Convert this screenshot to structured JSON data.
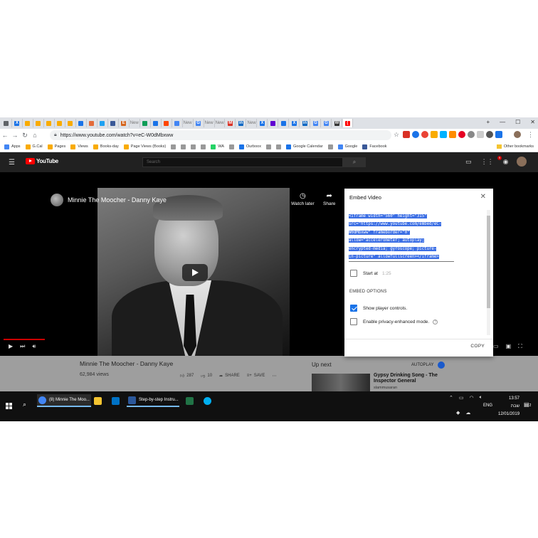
{
  "browser": {
    "tabs": [
      {
        "icon": "settings-icon",
        "label": "",
        "color": "#5f6368"
      },
      {
        "icon": "x-icon",
        "label": "X",
        "color": "#1a73e8"
      },
      {
        "icon": "analytics-icon",
        "label": "",
        "color": "#f9ab00"
      },
      {
        "icon": "analytics-icon",
        "label": "",
        "color": "#f9ab00"
      },
      {
        "icon": "analytics-icon",
        "label": "",
        "color": "#f9ab00"
      },
      {
        "icon": "analytics-icon",
        "label": "",
        "color": "#f9ab00"
      },
      {
        "icon": "analytics-icon",
        "label": "",
        "color": "#f9ab00"
      },
      {
        "icon": "calendar-icon",
        "label": "",
        "color": "#1a73e8"
      },
      {
        "icon": "sun-icon",
        "label": "",
        "color": "#e36c3b"
      },
      {
        "icon": "compass-icon",
        "label": "",
        "color": "#1da1f2"
      },
      {
        "icon": "facebook-icon",
        "label": "",
        "color": "#3b5998"
      },
      {
        "icon": "etsy-icon",
        "label": "E",
        "color": "#d5641c"
      },
      {
        "icon": "doc-icon",
        "label": "New",
        "color": "#777"
      },
      {
        "icon": "sheet-icon",
        "label": "",
        "color": "#0f9d58"
      },
      {
        "icon": "calendar-icon",
        "label": "",
        "color": "#1a73e8"
      },
      {
        "icon": "reddit-icon",
        "label": "",
        "color": "#ff4500"
      },
      {
        "icon": "chrome-icon",
        "label": "",
        "color": "#4285f4"
      },
      {
        "icon": "doc-icon",
        "label": "New",
        "color": "#777"
      },
      {
        "icon": "google-icon",
        "label": "G",
        "color": "#4285f4"
      },
      {
        "icon": "doc-icon",
        "label": "New",
        "color": "#777"
      },
      {
        "icon": "doc-icon",
        "label": "New",
        "color": "#777"
      },
      {
        "icon": "gmail-icon",
        "label": "M",
        "color": "#d93025"
      },
      {
        "icon": "linkedin-icon",
        "label": "in",
        "color": "#0a66c2"
      },
      {
        "icon": "doc-icon",
        "label": "New",
        "color": "#777"
      },
      {
        "icon": "x-icon",
        "label": "X",
        "color": "#1a73e8"
      },
      {
        "icon": "yahoo-icon",
        "label": "",
        "color": "#6001d2"
      },
      {
        "icon": "calendar-icon",
        "label": "",
        "color": "#1a73e8"
      },
      {
        "icon": "x-icon",
        "label": "X",
        "color": "#1a73e8"
      },
      {
        "icon": "linkedin-icon",
        "label": "in",
        "color": "#0a66c2"
      },
      {
        "icon": "google-icon",
        "label": "G",
        "color": "#4285f4"
      },
      {
        "icon": "google-icon",
        "label": "G",
        "color": "#4285f4"
      },
      {
        "icon": "wikipedia-icon",
        "label": "W",
        "color": "#333"
      },
      {
        "icon": "youtube-icon",
        "label": "(",
        "color": "#ff0000"
      }
    ],
    "url": "https://www.youtube.com/watch?v=eC-W0dMbxww",
    "bookmarks": [
      {
        "label": "Apps",
        "color": "#4285f4"
      },
      {
        "label": "G.Cal",
        "color": "#f9ab00"
      },
      {
        "label": "Pages",
        "color": "#f9ab00"
      },
      {
        "label": "Views",
        "color": "#f9ab00"
      },
      {
        "label": "Books-day",
        "color": "#f9ab00"
      },
      {
        "label": "Page Views (Books)",
        "color": "#f9ab00"
      },
      {
        "label": "",
        "color": "#999"
      },
      {
        "label": "",
        "color": "#999"
      },
      {
        "label": "",
        "color": "#999"
      },
      {
        "label": "",
        "color": "#999"
      },
      {
        "label": "WA",
        "color": "#25d366"
      },
      {
        "label": "",
        "color": "#999"
      },
      {
        "label": "Ourboox",
        "color": "#1a73e8"
      },
      {
        "label": "",
        "color": "#999"
      },
      {
        "label": "",
        "color": "#999"
      },
      {
        "label": "Google Calendar",
        "color": "#1a73e8"
      },
      {
        "label": "",
        "color": "#999"
      },
      {
        "label": "Google",
        "color": "#4285f4"
      },
      {
        "label": "Facebook",
        "color": "#3b5998"
      }
    ],
    "other_bookmarks": "Other bookmarks"
  },
  "youtube": {
    "logo_text": "YouTube",
    "search_placeholder": "Search",
    "notification_count": "9",
    "player": {
      "title": "Minnie The Moocher - Danny Kaye",
      "watch_later": "Watch later",
      "share": "Share"
    },
    "video_title": "Minnie The Moocher - Danny Kaye",
    "views": "62,984 views",
    "likes": "287",
    "dislikes": "10",
    "share_label": "SHARE",
    "save_label": "SAVE",
    "up_next": "Up next",
    "autoplay": "AUTOPLAY",
    "recommended": {
      "title": "Gypsy Drinking Song - The Inspector General",
      "channel": "slammusaran"
    }
  },
  "embed_dialog": {
    "title": "Embed Video",
    "code_lines": [
      "<iframe width=\"560\" height=\"315\"",
      "src=\"https://www.youtube.com/embed/eC-",
      "W0dMbxww\" frameborder=\"0\"",
      "allow=\"accelerometer; autoplay;",
      "encrypted-media; gyroscope; picture-",
      "in-picture\" allowfullscreen></iframe>"
    ],
    "start_at_label": "Start at",
    "start_at_value": "1:25",
    "section_label": "EMBED OPTIONS",
    "show_controls_label": "Show player controls.",
    "privacy_label": "Enable privacy-enhanced mode.",
    "copy_label": "COPY",
    "start_at_checked": false,
    "show_controls_checked": true,
    "privacy_checked": false
  },
  "taskbar": {
    "items": [
      {
        "label": "(8) Minnie The Moo...",
        "icon": "chrome-icon",
        "color": "#4285f4"
      },
      {
        "label": "",
        "icon": "folder-icon",
        "color": "#f4c430"
      },
      {
        "label": "",
        "icon": "outlook-icon",
        "color": "#0072c6"
      },
      {
        "label": "Step-by-step Instru...",
        "icon": "word-icon",
        "color": "#2b579a"
      },
      {
        "label": "",
        "icon": "excel-icon",
        "color": "#217346"
      },
      {
        "label": "",
        "icon": "skype-icon",
        "color": "#00aff0"
      }
    ],
    "language": "ENG",
    "time": "13:57",
    "day": "שבת",
    "date": "12/01/2019",
    "notifications": "2"
  }
}
